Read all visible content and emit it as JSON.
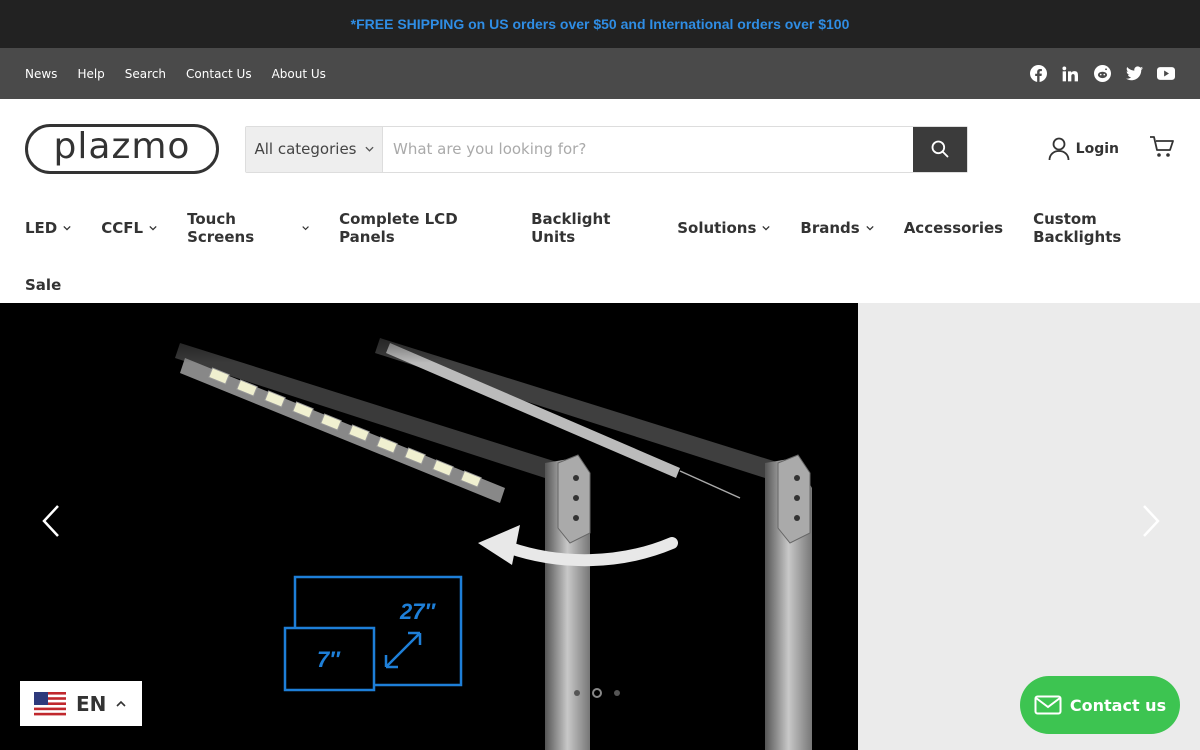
{
  "announcement": "*FREE SHIPPING on US orders over $50 and International orders over $100",
  "utility_links": [
    "News",
    "Help",
    "Search",
    "Contact Us",
    "About Us"
  ],
  "social_icons": [
    "facebook-icon",
    "linkedin-icon",
    "reddit-icon",
    "twitter-icon",
    "youtube-icon"
  ],
  "logo_text": "plazmo",
  "search": {
    "category": "All categories",
    "placeholder": "What are you looking for?"
  },
  "header": {
    "login_label": "Login"
  },
  "nav": {
    "items": [
      {
        "label": "LED",
        "dropdown": true
      },
      {
        "label": "CCFL",
        "dropdown": true
      },
      {
        "label": "Touch Screens",
        "dropdown": true
      },
      {
        "label": "Complete LCD Panels",
        "dropdown": false
      },
      {
        "label": "Backlight Units",
        "dropdown": false
      },
      {
        "label": "Solutions",
        "dropdown": true
      },
      {
        "label": "Brands",
        "dropdown": true
      },
      {
        "label": "Accessories",
        "dropdown": false
      },
      {
        "label": "Custom Backlights",
        "dropdown": false
      },
      {
        "label": "Sale",
        "dropdown": false
      }
    ]
  },
  "hero": {
    "size_large": "27″",
    "size_small": "7″",
    "slides": 3,
    "active_slide": 2
  },
  "language": {
    "code": "EN"
  },
  "contact_widget": {
    "label": "Contact us"
  },
  "colors": {
    "announce_bg": "#222222",
    "announce_text": "#2f8de4",
    "utility_bg": "#4a4a4a",
    "contact_green": "#3dc451"
  }
}
